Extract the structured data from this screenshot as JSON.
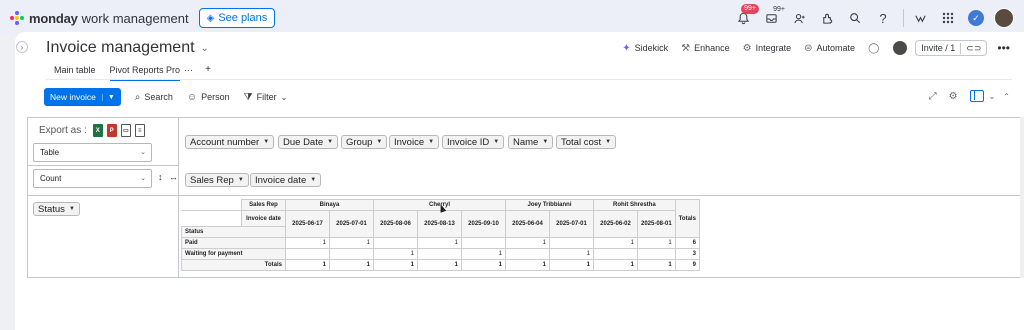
{
  "topbar": {
    "logo_name": "monday",
    "logo_sub": "work management",
    "see_plans": "See plans",
    "notif_badge": "99+",
    "inbox_badge": "99+",
    "icons": [
      "bell-icon",
      "inbox-icon",
      "invite-members-icon",
      "apps-icon",
      "search-icon",
      "help-icon",
      "integrations-icon",
      "app-grid-icon",
      "avatar"
    ]
  },
  "board": {
    "title": "Invoice management",
    "actions": {
      "sidekick": "Sidekick",
      "enhance": "Enhance",
      "integrate": "Integrate",
      "automate": "Automate",
      "invite": "Invite / 1"
    },
    "tabs": [
      {
        "label": "Main table"
      },
      {
        "label": "Pivot Reports Pro"
      }
    ],
    "toolbar": {
      "new_item": "New invoice",
      "search": "Search",
      "person": "Person",
      "filter": "Filter"
    }
  },
  "pivot": {
    "export_label": "Export as :",
    "renderer": "Table",
    "aggregator": "Count",
    "unused_fields": [
      "Account number",
      "Due Date",
      "Group",
      "Invoice",
      "Invoice ID",
      "Name",
      "Total cost"
    ],
    "col_fields": [
      "Sales Rep",
      "Invoice date"
    ],
    "row_fields": [
      "Status"
    ],
    "table": {
      "col_header_1": "Sales Rep",
      "col_header_2": "Invoice date",
      "row_header": "Status",
      "totals_label": "Totals",
      "reps": [
        {
          "name": "Binaya",
          "dates": [
            "2025-06-17",
            "2025-07-01"
          ]
        },
        {
          "name": "Cherryl",
          "dates": [
            "2025-08-06",
            "2025-08-13",
            "2025-09-10"
          ]
        },
        {
          "name": "Joey Tribbianni",
          "dates": [
            "2025-06-04",
            "2025-07-01"
          ]
        },
        {
          "name": "Rohit Shrestha",
          "dates": [
            "2025-06-02",
            "2025-08-01"
          ]
        }
      ],
      "rows": [
        {
          "status": "Paid",
          "values": [
            "1",
            "1",
            "",
            "1",
            "",
            "1",
            "",
            "1",
            "1"
          ],
          "total": "6"
        },
        {
          "status": "Waiting for payment",
          "values": [
            "",
            "",
            "1",
            "",
            "1",
            "",
            "1",
            "",
            ""
          ],
          "total": "3"
        }
      ],
      "column_totals": [
        "1",
        "1",
        "1",
        "1",
        "1",
        "1",
        "1",
        "1",
        "1"
      ],
      "grand_total": "9"
    }
  },
  "colors": {
    "primary": "#0073ea",
    "badge": "#e2445c",
    "background": "#eef0f4"
  }
}
